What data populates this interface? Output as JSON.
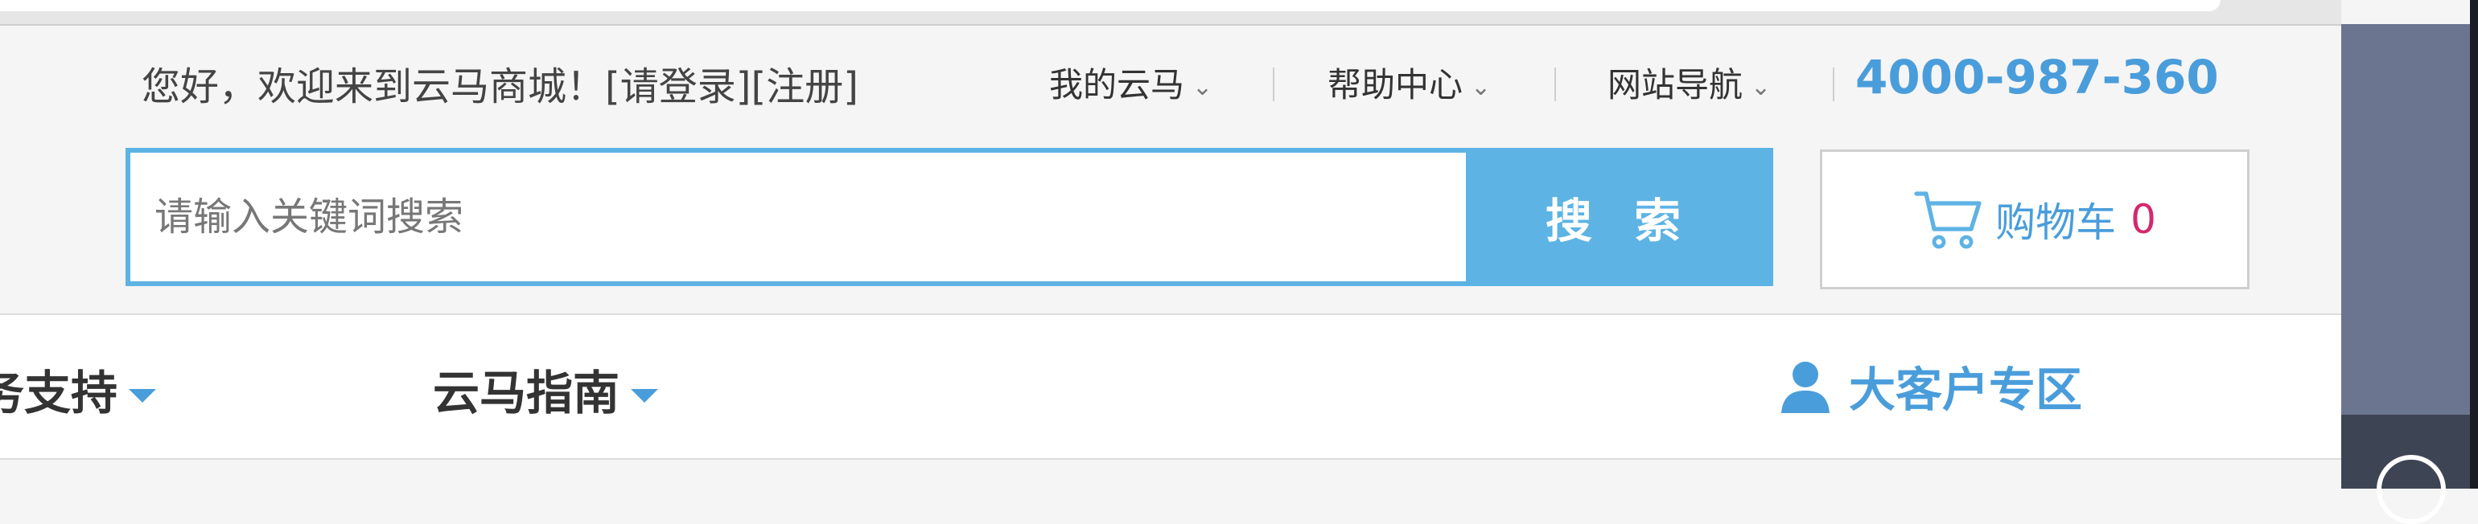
{
  "topbar": {
    "welcome_text": "您好，欢迎来到云马商城！",
    "login_link": "[请登录]",
    "register_link": "[注册]",
    "nav": [
      {
        "label": "我的云马"
      },
      {
        "label": "帮助中心"
      },
      {
        "label": "网站导航"
      }
    ],
    "hotline": "4000-987-360"
  },
  "search": {
    "placeholder": "请输入关键词搜索",
    "button_label": "搜 索"
  },
  "cart": {
    "label": "购物车",
    "count": "0"
  },
  "mainnav": {
    "items": [
      {
        "label": "务支持"
      },
      {
        "label": "云马指南"
      }
    ],
    "vip_label": "大客户专区"
  },
  "colors": {
    "accent": "#5db3e4",
    "link_blue": "#4a9ddb",
    "cart_count": "#d4286e"
  }
}
